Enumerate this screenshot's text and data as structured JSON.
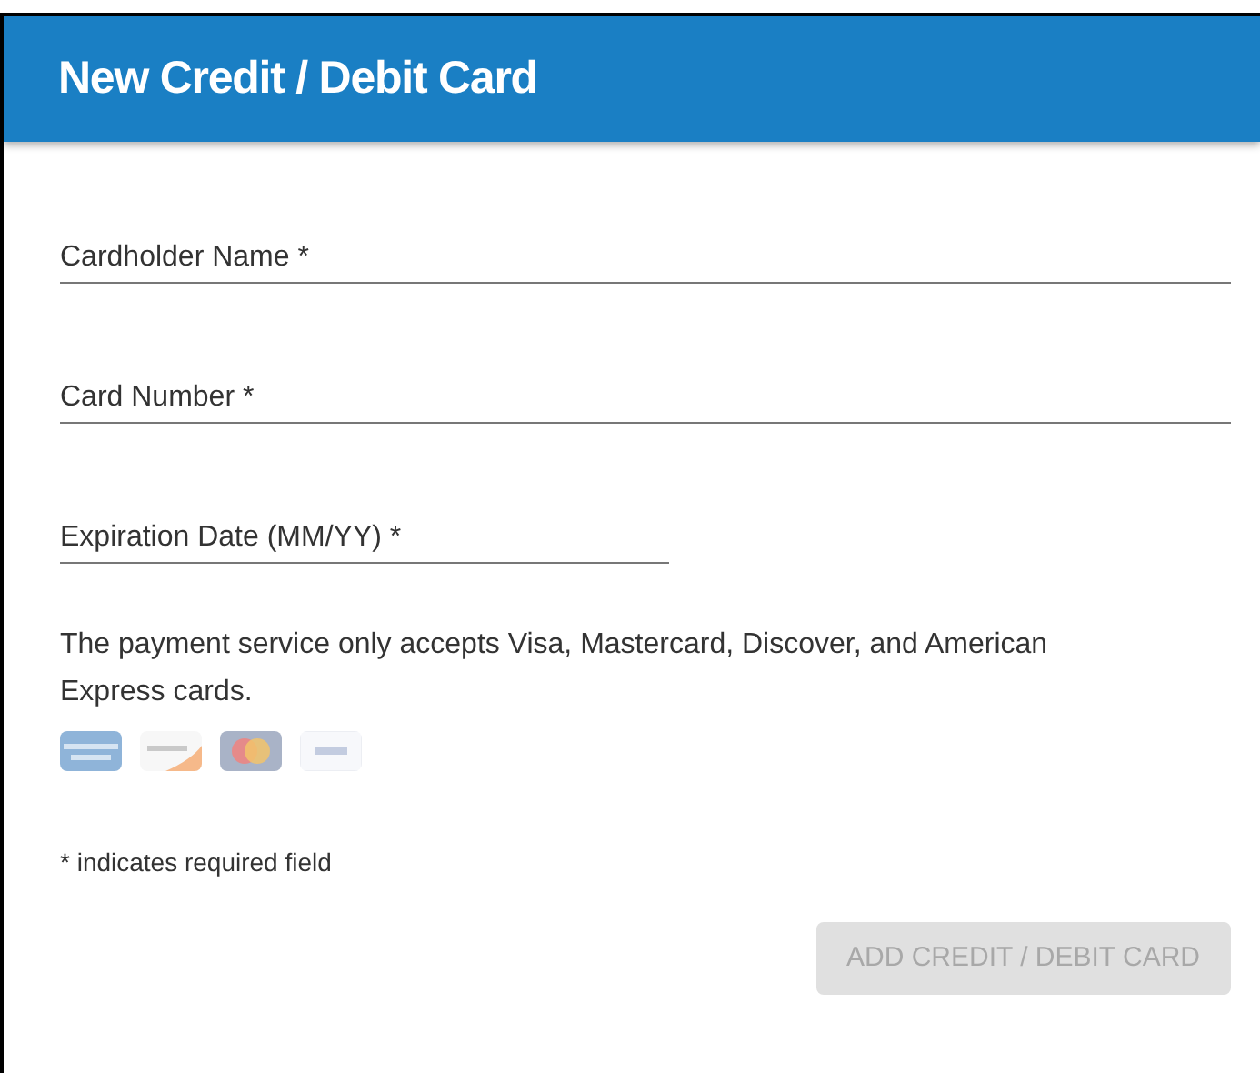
{
  "header": {
    "title": "New Credit / Debit Card"
  },
  "fields": [
    {
      "placeholder": "Cardholder Name *",
      "kind": "wide"
    },
    {
      "placeholder": "Card Number *",
      "kind": "wide"
    },
    {
      "placeholder": "Expiration Date (MM/YY) *",
      "kind": "narrow"
    }
  ],
  "notice": "The payment service only accepts Visa, Mastercard, Discover, and American Express cards.",
  "card_logos": [
    {
      "kind": "amex"
    },
    {
      "kind": "discover"
    },
    {
      "kind": "mastercard"
    },
    {
      "kind": "visa"
    }
  ],
  "required_note": "* indicates required field",
  "submit_button": {
    "label": "ADD CREDIT / DEBIT CARD",
    "disabled": true
  }
}
